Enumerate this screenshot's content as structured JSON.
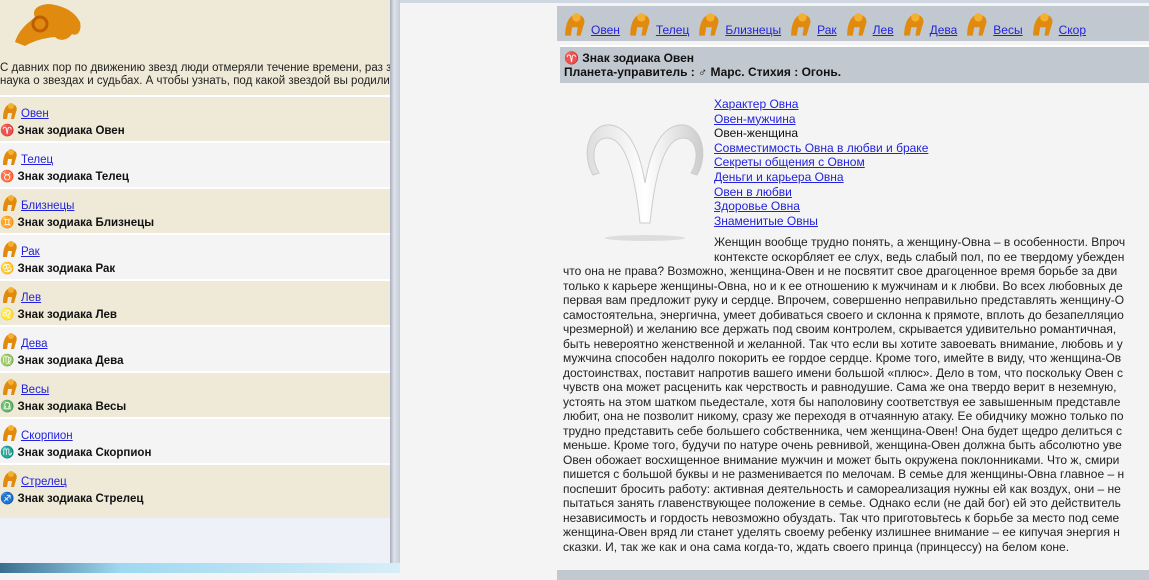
{
  "left": {
    "intro": [
      "С давних пор по движению звезд люди отмеряли течение времени, раз за р",
      "наука о звездах и судьбах. А чтобы узнать, под какой звездой вы родились,"
    ],
    "signs": [
      {
        "name": "Овен",
        "symbol": "♈",
        "label": "Знак зодиака Овен"
      },
      {
        "name": "Телец",
        "symbol": "♉",
        "label": "Знак зодиака Телец"
      },
      {
        "name": "Близнецы",
        "symbol": "♊",
        "label": "Знак зодиака Близнецы"
      },
      {
        "name": "Рак",
        "symbol": "♋",
        "label": "Знак зодиака Рак"
      },
      {
        "name": "Лев",
        "symbol": "♌",
        "label": "Знак зодиака Лев"
      },
      {
        "name": "Дева",
        "symbol": "♍",
        "label": "Знак зодиака Дева"
      },
      {
        "name": "Весы",
        "symbol": "♎",
        "label": "Знак зодиака Весы"
      },
      {
        "name": "Скорпион",
        "symbol": "♏",
        "label": "Знак зодиака Скорпион"
      },
      {
        "name": "Стрелец",
        "symbol": "♐",
        "label": "Знак зодиака Стрелец"
      }
    ]
  },
  "nav": [
    "Овен",
    "Телец",
    "Близнецы",
    "Рак",
    "Лев",
    "Дева",
    "Весы",
    "Скор"
  ],
  "title": {
    "line1": "♈ Знак зодиака Овен",
    "line2": "Планета-управитель : ♂ Марс. Стихия : Огонь."
  },
  "links": [
    "Характер Овна",
    "Овен-мужчина",
    "Овен-женщина",
    "Совместимость Овна в любви и браке",
    "Секреты общения с Овном",
    "Деньги и карьера Овна",
    "Овен в любви",
    "Здоровье Овна",
    "Знаменитые Овны"
  ],
  "links_current": 2,
  "paragraph": [
    "Женщин вообще трудно понять, а женщину-Овна – в особенности. Впроч",
    "контексте оскорбляет ее слух, ведь слабый пол, по ее твердому убежден",
    "что она не права? Возможно, женщина-Овен и не посвятит свое драгоценное время борьбе за дви",
    "только к карьере женщины-Овна, но и к ее отношению к мужчинам и к любви. Во всех любовных де",
    "первая вам предложит руку и сердце. Впрочем, совершенно неправильно представлять женщину-О",
    "самостоятельна, энергична, умеет добиваться своего и склонна к прямоте, вплоть до безапелляцио",
    "чрезмерной) и желанию все держать под своим контролем, скрывается удивительно романтичная,",
    "быть невероятно женственной и желанной. Так что если вы хотите завоевать внимание, любовь и у",
    "мужчина способен надолго покорить ее гордое сердце. Кроме того, имейте в виду, что женщина-Ов",
    "достоинствах, поставит напротив вашего имени большой «плюс». Дело в том, что поскольку Овен с",
    "чувств она может расценить как черствость и равнодушие. Сама же она твердо верит в неземную,",
    "устоять на этом шатком пьедестале, хотя бы наполовину соответствуя ее завышенным представле",
    "любит, она не позволит никому, сразу же переходя в отчаянную атаку. Ее обидчику можно только по",
    "трудно представить себе большего собственника, чем женщина-Овен! Она будет щедро делиться с",
    "меньше. Кроме того, будучи по натуре очень ревнивой, женщина-Овен должна быть абсолютно уве",
    "Овен обожает восхищенное внимание мужчин и может быть окружена поклонниками. Что ж, смири",
    "пишется с большой буквы и не разменивается по мелочам. В семье для женщины-Овна главное – н",
    "поспешит бросить работу: активная деятельность и самореализация нужны ей как воздух, они – не",
    "пытаться занять главенствующее положение в семье. Однако если (не дай бог) ей это действитель",
    "независимость и гордость невозможно обуздать. Так что приготовьтесь к борьбе за место под семе",
    "женщина-Овен вряд ли станет уделять своему ребенку излишнее внимание – ее кипучая энергия н",
    "сказки. И, так же как и она сама когда-то, ждать своего принца (принцессу) на белом коне."
  ],
  "colors": {
    "icon": "#e08a10",
    "link": "#2222dd",
    "panel": "#c2c8d0",
    "beige": "#eeead7"
  }
}
